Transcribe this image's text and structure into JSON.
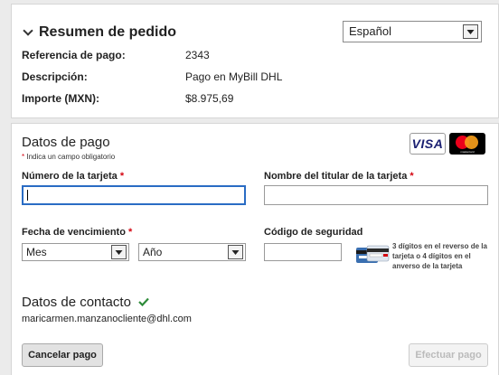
{
  "summary": {
    "title": "Resumen de pedido",
    "language": "Español",
    "rows": [
      {
        "label": "Referencia de pago:",
        "value": "2343"
      },
      {
        "label": "Descripción:",
        "value": "Pago en MyBill DHL"
      },
      {
        "label": "Importe (MXN):",
        "value": "$8.975,69"
      }
    ]
  },
  "payment": {
    "title": "Datos de pago",
    "required_note": "Indica un campo obligatorio",
    "required_mark": "*",
    "cards": {
      "visa": "VISA",
      "mastercard": "mastercard"
    },
    "card_number_label": "Número de la tarjeta",
    "card_number_value": "",
    "holder_label": "Nombre del titular de la tarjeta",
    "holder_value": "",
    "expiry_label": "Fecha de vencimiento",
    "month_value": "Mes",
    "year_value": "Año",
    "cvv_label": "Código de seguridad",
    "cvv_value": "",
    "cvv_hint": "3 dígitos en el reverso de la tarjeta o 4 dígitos en el anverso de la tarjeta"
  },
  "contact": {
    "title": "Datos de contacto",
    "email": "maricarmen.manzanocliente@dhl.com"
  },
  "buttons": {
    "cancel": "Cancelar pago",
    "submit": "Efectuar pago"
  },
  "colors": {
    "required": "#d40511",
    "check": "#2e8b3a",
    "focus": "#2a6cc4"
  },
  "icons": [
    "chevron-down-icon",
    "dropdown-arrow-icon",
    "visa-logo",
    "mastercard-logo",
    "cvv-card-icon",
    "checkmark-icon"
  ]
}
